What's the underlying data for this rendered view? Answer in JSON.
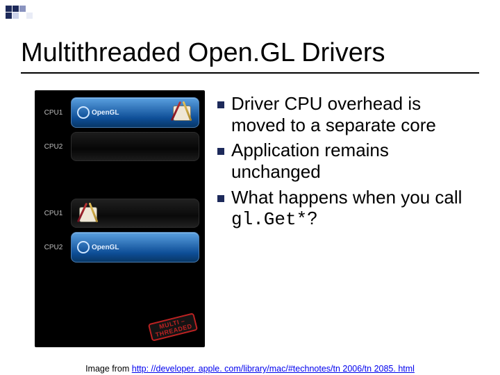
{
  "title": "Multithreaded Open.GL Drivers",
  "bullets": [
    "Driver CPU overhead is moved to a separate core",
    "Application remains unchanged"
  ],
  "bullet3_prefix": "What happens when you call ",
  "bullet3_code": "gl.Get*",
  "bullet3_suffix": "?",
  "figure": {
    "cpu1": "CPU1",
    "cpu2": "CPU2",
    "opengl": "OpenGL",
    "stamp_line1": "MULTI –",
    "stamp_line2": "THREADED"
  },
  "credit": {
    "label": "Image from ",
    "url_text": "http: //developer. apple. com/library/mac/#technotes/tn 2006/tn 2085. html"
  }
}
